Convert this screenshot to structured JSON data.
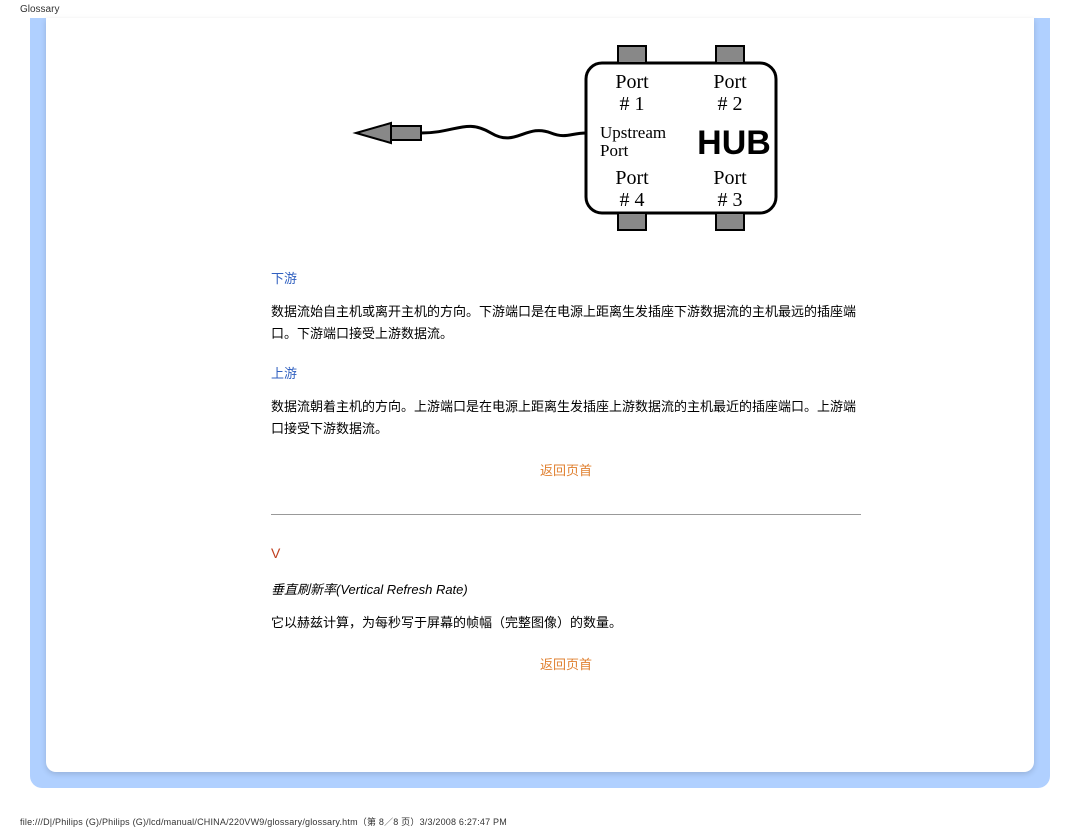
{
  "header": {
    "label": "Glossary"
  },
  "diagram": {
    "port1": "Port\n# 1",
    "port2": "Port\n# 2",
    "port4": "Port\n# 4",
    "port3": "Port\n# 3",
    "upstream": "Upstream\nPort",
    "hub": "HUB"
  },
  "section_downstream": {
    "title": "下游",
    "body": "数据流始自主机或离开主机的方向。下游端口是在电源上距离生发插座下游数据流的主机最远的插座端口。下游端口接受上游数据流。"
  },
  "section_upstream": {
    "title": "上游",
    "body": "数据流朝着主机的方向。上游端口是在电源上距离生发插座上游数据流的主机最近的插座端口。上游端口接受下游数据流。"
  },
  "section_v": {
    "letter": "V",
    "term": "垂直刷新率(Vertical Refresh Rate)",
    "body": "它以赫兹计算，为每秒写于屏幕的帧幅（完整图像）的数量。"
  },
  "links": {
    "back_to_top": "返回页首"
  },
  "footer": {
    "path": "file:///D|/Philips (G)/Philips (G)/lcd/manual/CHINA/220VW9/glossary/glossary.htm（第 8／8 页）3/3/2008 6:27:47 PM"
  }
}
